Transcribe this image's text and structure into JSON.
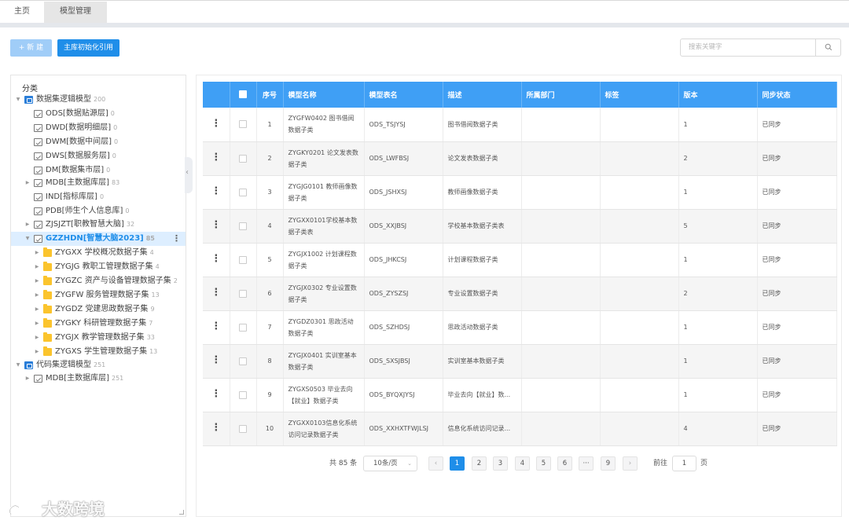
{
  "tabs": [
    {
      "label": "主页"
    },
    {
      "label": "模型管理"
    }
  ],
  "toolbar": {
    "new_label": "+ 新 建",
    "init_label": "主库初始化引用",
    "search_placeholder": "搜索关键字"
  },
  "tree": {
    "title": "分类",
    "nodes": [
      {
        "label": "数据集逻辑模型",
        "count": "200",
        "icon": "database-icon"
      },
      {
        "label": "ODS[数据贴源层]",
        "count": "0",
        "icon": "table-icon"
      },
      {
        "label": "DWD[数据明细层]",
        "count": "0",
        "icon": "table-icon"
      },
      {
        "label": "DWM[数据中间层]",
        "count": "0",
        "icon": "table-icon"
      },
      {
        "label": "DWS[数据服务层]",
        "count": "0",
        "icon": "table-icon"
      },
      {
        "label": "DM[数据集市层]",
        "count": "0",
        "icon": "table-icon"
      },
      {
        "label": "MDB[主数据库层]",
        "count": "83",
        "icon": "table-icon"
      },
      {
        "label": "IND[指标库层]",
        "count": "0",
        "icon": "table-icon"
      },
      {
        "label": "PDB[师生个人信息库]",
        "count": "0",
        "icon": "table-icon"
      },
      {
        "label": "ZJSJZT[职教智慧大脑]",
        "count": "32",
        "icon": "table-icon"
      },
      {
        "label": "GZZHDN[智慧大脑2023]",
        "count": "85",
        "icon": "table-icon"
      },
      {
        "label": "ZYGXX 学校概况数据子集",
        "count": "4",
        "icon": "folder-icon"
      },
      {
        "label": "ZYGJG 教职工管理数据子集",
        "count": "4",
        "icon": "folder-icon"
      },
      {
        "label": "ZYGZC 资产与设备管理数据子集",
        "count": "2",
        "icon": "folder-icon"
      },
      {
        "label": "ZYGFW 服务管理数据子集",
        "count": "13",
        "icon": "folder-icon"
      },
      {
        "label": "ZYGDZ 党建思政数据子集",
        "count": "9",
        "icon": "folder-icon"
      },
      {
        "label": "ZYGKY 科研管理数据子集",
        "count": "7",
        "icon": "folder-icon"
      },
      {
        "label": "ZYGJX 教学管理数据子集",
        "count": "33",
        "icon": "folder-icon"
      },
      {
        "label": "ZYGXS 学生管理数据子集",
        "count": "13",
        "icon": "folder-icon"
      },
      {
        "label": "代码集逻辑模型",
        "count": "251",
        "icon": "database-icon"
      },
      {
        "label": "MDB[主数据库层]",
        "count": "251",
        "icon": "table-icon"
      }
    ]
  },
  "table": {
    "headers": [
      "序号",
      "模型名称",
      "模型表名",
      "描述",
      "所属部门",
      "标签",
      "版本",
      "同步状态"
    ],
    "rows": [
      {
        "no": "1",
        "name": "ZYGFW0402 图书借阅数据子类",
        "table": "ODS_TSJYSJ",
        "desc": "图书借阅数据子类",
        "dept": "",
        "tag": "",
        "ver": "1",
        "sync": "已同步"
      },
      {
        "no": "2",
        "name": "ZYGKY0201 论文发表数据子类",
        "table": "ODS_LWFBSJ",
        "desc": "论文发表数据子类",
        "dept": "",
        "tag": "",
        "ver": "2",
        "sync": "已同步"
      },
      {
        "no": "3",
        "name": "ZYGJG0101 教师画像数据子类",
        "table": "ODS_JSHXSJ",
        "desc": "教师画像数据子类",
        "dept": "",
        "tag": "",
        "ver": "1",
        "sync": "已同步"
      },
      {
        "no": "4",
        "name": "ZYGXX0101学校基本数据子类表",
        "table": "ODS_XXJBSJ",
        "desc": "学校基本数据子类表",
        "dept": "",
        "tag": "",
        "ver": "5",
        "sync": "已同步"
      },
      {
        "no": "5",
        "name": "ZYGJX1002 计划课程数据子类",
        "table": "ODS_JHKCSJ",
        "desc": "计划课程数据子类",
        "dept": "",
        "tag": "",
        "ver": "1",
        "sync": "已同步"
      },
      {
        "no": "6",
        "name": "ZYGJX0302 专业设置数据子类",
        "table": "ODS_ZYSZSJ",
        "desc": "专业设置数据子类",
        "dept": "",
        "tag": "",
        "ver": "2",
        "sync": "已同步"
      },
      {
        "no": "7",
        "name": "ZYGDZ0301 思政活动数据子类",
        "table": "ODS_SZHDSJ",
        "desc": "思政活动数据子类",
        "dept": "",
        "tag": "",
        "ver": "1",
        "sync": "已同步"
      },
      {
        "no": "8",
        "name": "ZYGJX0401 实训室基本数据子类",
        "table": "ODS_SXSJBSJ",
        "desc": "实训室基本数据子类",
        "dept": "",
        "tag": "",
        "ver": "1",
        "sync": "已同步"
      },
      {
        "no": "9",
        "name": "ZYGXS0503 毕业去向【就业】数据子类",
        "table": "ODS_BYQXJYSJ",
        "desc": "毕业去向【就业】数...",
        "dept": "",
        "tag": "",
        "ver": "1",
        "sync": "已同步"
      },
      {
        "no": "10",
        "name": "ZYGXX0103信息化系统访问记录数据子类",
        "table": "ODS_XXHXTFWJLSJ",
        "desc": "信息化系统访问记录...",
        "dept": "",
        "tag": "",
        "ver": "4",
        "sync": "已同步"
      }
    ]
  },
  "pagination": {
    "total": "共 85 条",
    "page_size": "10条/页",
    "pages": [
      "1",
      "2",
      "3",
      "4",
      "5",
      "6",
      "···",
      "9"
    ],
    "current": "1",
    "goto_label": "前往",
    "goto_value": "1",
    "page_suffix": "页"
  },
  "watermark": {
    "text": "大数跨境"
  },
  "colors": {
    "primary": "#1f8ee9",
    "header": "#3f9ff5",
    "folder": "#fbc42d",
    "database": "#2b7ed8"
  }
}
